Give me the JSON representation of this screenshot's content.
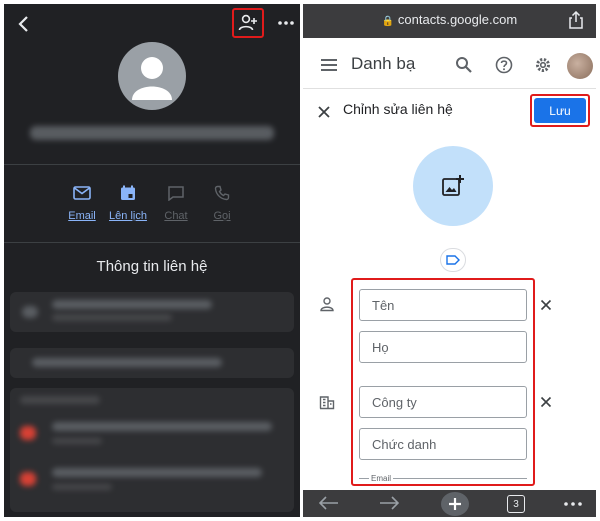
{
  "left_panel": {
    "actions": [
      {
        "label": "Email",
        "icon": "email-icon",
        "enabled": true
      },
      {
        "label": "Lên lịch",
        "icon": "calendar-icon",
        "enabled": true
      },
      {
        "label": "Chat",
        "icon": "chat-icon",
        "enabled": false
      },
      {
        "label": "Gọi",
        "icon": "phone-icon",
        "enabled": false
      }
    ],
    "section_title": "Thông tin liên hệ"
  },
  "right_panel": {
    "browser": {
      "url": "contacts.google.com",
      "tab_count": "3"
    },
    "app": {
      "title": "Danh bạ"
    },
    "edit": {
      "title": "Chỉnh sửa liên hệ",
      "save_label": "Lưu"
    },
    "fields": {
      "first_name_placeholder": "Tên",
      "last_name_placeholder": "Họ",
      "company_placeholder": "Công ty",
      "job_title_placeholder": "Chức danh",
      "email_label": "Email"
    }
  },
  "colors": {
    "accent": "#1a73e8",
    "highlight": "#e01b1b",
    "dark_bg": "#202124"
  }
}
